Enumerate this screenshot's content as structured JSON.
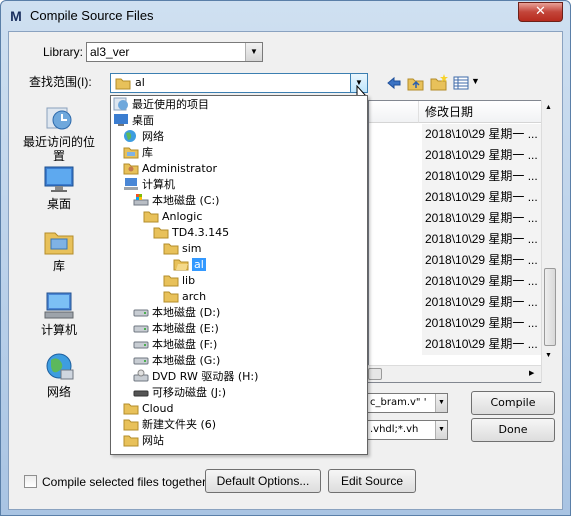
{
  "window": {
    "title": "Compile Source Files",
    "close_glyph": "✕",
    "app_icon_letter": "M"
  },
  "library": {
    "label": "Library:",
    "value": "al3_ver"
  },
  "look_in": {
    "label": "查找范围(I):",
    "value": "al"
  },
  "toolbar": {
    "back_icon": "back-arrow-icon",
    "up_icon": "up-folder-icon",
    "new_folder_icon": "new-folder-icon",
    "view_icon": "view-menu-icon"
  },
  "places": [
    {
      "label": "最近访问的位置",
      "icon": "recent-places-icon"
    },
    {
      "label": "桌面",
      "icon": "desktop-icon"
    },
    {
      "label": "库",
      "icon": "libraries-icon"
    },
    {
      "label": "计算机",
      "icon": "computer-icon"
    },
    {
      "label": "网络",
      "icon": "network-icon"
    }
  ],
  "file_list": {
    "column_modified": "修改日期",
    "rows": [
      "2018\\10\\29 星期一 ...",
      "2018\\10\\29 星期一 ...",
      "2018\\10\\29 星期一 ...",
      "2018\\10\\29 星期一 ...",
      "2018\\10\\29 星期一 ...",
      "2018\\10\\29 星期一 ...",
      "2018\\10\\29 星期一 ...",
      "2018\\10\\29 星期一 ...",
      "2018\\10\\29 星期一 ...",
      "2018\\10\\29 星期一 ...",
      "2018\\10\\29 星期一 ..."
    ]
  },
  "file_name_field": {
    "value": "c_bram.v\" '"
  },
  "file_type_field": {
    "value": ".vhdl;*.vh"
  },
  "buttons": {
    "compile": "Compile",
    "done": "Done",
    "default_options": "Default Options...",
    "edit_source": "Edit Source"
  },
  "compile_together": {
    "label": "Compile selected files together",
    "checked": false
  },
  "lookin_dropdown": [
    {
      "label": "最近使用的项目",
      "indent": 0,
      "icon": "recent-icon"
    },
    {
      "label": "桌面",
      "indent": 0,
      "icon": "desktop-icon"
    },
    {
      "label": "网络",
      "indent": 1,
      "icon": "network-icon"
    },
    {
      "label": "库",
      "indent": 1,
      "icon": "libraries-icon"
    },
    {
      "label": "Administrator",
      "indent": 1,
      "icon": "user-folder-icon"
    },
    {
      "label": "计算机",
      "indent": 1,
      "icon": "computer-icon"
    },
    {
      "label": "本地磁盘 (C:)",
      "indent": 2,
      "icon": "system-drive-icon"
    },
    {
      "label": "Anlogic",
      "indent": 3,
      "icon": "folder-icon"
    },
    {
      "label": "TD4.3.145",
      "indent": 4,
      "icon": "folder-icon"
    },
    {
      "label": "sim",
      "indent": 5,
      "icon": "folder-icon"
    },
    {
      "label": "al",
      "indent": 6,
      "icon": "open-folder-icon",
      "selected": true
    },
    {
      "label": "lib",
      "indent": 5,
      "icon": "folder-icon"
    },
    {
      "label": "arch",
      "indent": 5,
      "icon": "folder-icon"
    },
    {
      "label": "本地磁盘 (D:)",
      "indent": 2,
      "icon": "drive-icon"
    },
    {
      "label": "本地磁盘 (E:)",
      "indent": 2,
      "icon": "drive-icon"
    },
    {
      "label": "本地磁盘 (F:)",
      "indent": 2,
      "icon": "drive-icon"
    },
    {
      "label": "本地磁盘 (G:)",
      "indent": 2,
      "icon": "drive-icon"
    },
    {
      "label": "DVD RW 驱动器 (H:)",
      "indent": 2,
      "icon": "dvd-drive-icon"
    },
    {
      "label": "可移动磁盘 (J:)",
      "indent": 2,
      "icon": "removable-drive-icon"
    },
    {
      "label": "Cloud",
      "indent": 1,
      "icon": "folder-icon"
    },
    {
      "label": "新建文件夹 (6)",
      "indent": 1,
      "icon": "folder-icon"
    },
    {
      "label": "网站",
      "indent": 1,
      "icon": "folder-icon"
    }
  ],
  "colors": {
    "selection": "#3399ff",
    "folder": "#e8c15a"
  }
}
